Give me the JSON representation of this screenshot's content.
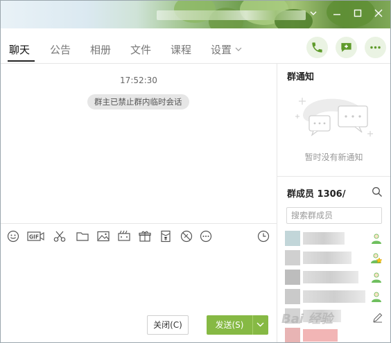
{
  "window": {
    "controls": [
      "chevron-down-icon",
      "minimize-icon",
      "maximize-icon",
      "close-icon"
    ]
  },
  "tabs": [
    {
      "label": "聊天",
      "active": true
    },
    {
      "label": "公告"
    },
    {
      "label": "相册"
    },
    {
      "label": "文件"
    },
    {
      "label": "课程"
    },
    {
      "label": "设置"
    }
  ],
  "header_actions": [
    "phone-icon",
    "add-message-icon",
    "more-icon"
  ],
  "accent_color": "#86b944",
  "chat": {
    "timestamp": "17:52:30",
    "system_message": "群主已禁止群内临时会话"
  },
  "toolbar": {
    "icons": [
      "emoji-icon",
      "gif-icon",
      "screenshot-scissors-icon",
      "folder-icon",
      "image-icon",
      "video-icon",
      "gift-icon",
      "red-envelope-icon",
      "block-icon",
      "more-dots-icon",
      "history-clock-icon"
    ]
  },
  "buttons": {
    "close_label": "关闭(C)",
    "send_label": "发送(S)"
  },
  "right_panel": {
    "notice_title": "群通知",
    "notice_empty": "暂时没有新通知",
    "members_title": "群成员 1306/",
    "member_search_placeholder": "搜索群成员"
  },
  "watermark": "Bai 经验"
}
